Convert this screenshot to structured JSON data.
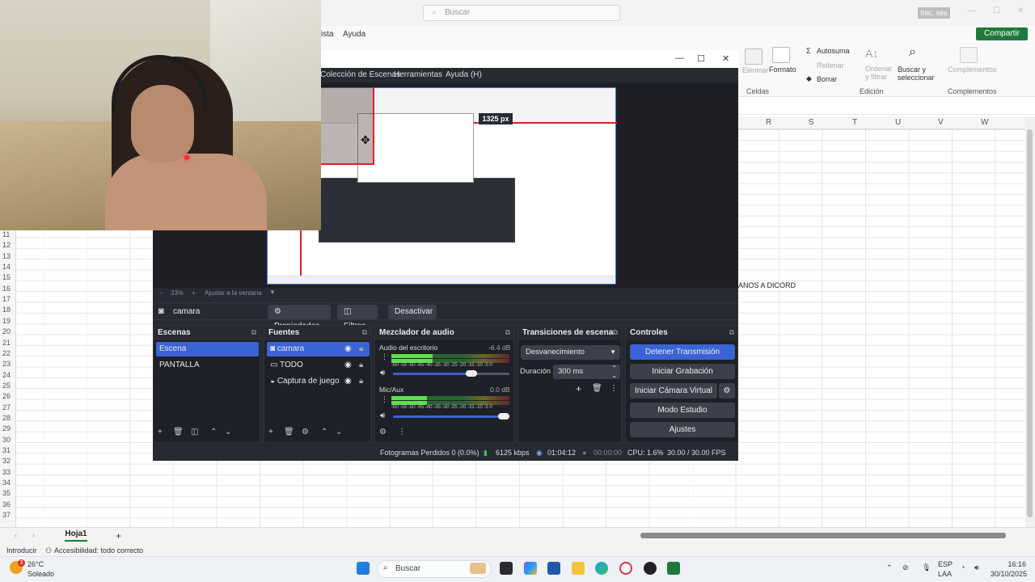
{
  "excel": {
    "search_placeholder": "Buscar",
    "signin": "Inic. ses",
    "menu": [
      "ista",
      "Ayuda"
    ],
    "share_label": "Compartir",
    "ribbon": {
      "autosuma": "Autosuma",
      "rellenar": "Rellenar",
      "borrar": "Borrar",
      "ordenar": "Ordenar y filtrar",
      "buscar": "Buscar y seleccionar",
      "complementos": "Complementos",
      "eliminar": "Eliminar",
      "formato": "Formato",
      "group_celdas": "Celdas",
      "group_edicion": "Edición",
      "group_complementos": "Complementos"
    },
    "columns": [
      "R",
      "S",
      "T",
      "U",
      "V",
      "W"
    ],
    "rows": [
      "11",
      "12",
      "13",
      "14",
      "15",
      "16",
      "17",
      "18",
      "19",
      "20",
      "21",
      "22",
      "23",
      "24",
      "25",
      "26",
      "27",
      "28",
      "29",
      "30",
      "31",
      "32",
      "33",
      "34",
      "35",
      "36",
      "37"
    ],
    "cell_text": "ANOS A DICORD",
    "sheet_tab": "Hoja1",
    "add_sheet": "+",
    "status_left": "Introducir",
    "status_access": "Accesibilidad: todo correcto"
  },
  "obs": {
    "menu": [
      "Colección de Escenas",
      "Herramientas",
      "Ayuda (H)"
    ],
    "px_label": "1325 px",
    "zoom_pct": "33%",
    "zoom_fit": "Ajustar a la ventana",
    "source_name": "camara",
    "src_buttons": {
      "props": "Propiedades",
      "filters": "Filtros",
      "deactivate": "Desactivar"
    },
    "docks": {
      "scenes": "Escenas",
      "sources": "Fuentes",
      "mixer": "Mezclador de audio",
      "transitions": "Transiciones de escena",
      "controls": "Controles"
    },
    "scenes": [
      "Escena",
      "PANTALLA"
    ],
    "sources": [
      "camara",
      "TODO",
      "Captura de juego"
    ],
    "mixer": [
      {
        "name": "Audio del escritorio",
        "db": "-6.4 dB",
        "level": 0.35,
        "volume": 0.72
      },
      {
        "name": "Mic/Aux",
        "db": "0.0 dB",
        "level": 0.3,
        "volume": 1.0
      }
    ],
    "meter_scale": "-60 -55 -50 -45 -40 -35 -30 -25 -20 -15 -10 -5 0",
    "transition": {
      "selected": "Desvanecimiento",
      "duration_label": "Duración",
      "duration": "300 ms"
    },
    "controls": [
      "Detener Transmisión",
      "Iniciar Grabación",
      "Iniciar Cámara Virtual",
      "Modo Estudio",
      "Ajustes"
    ],
    "status": {
      "dropped": "Fotogramas Perdidos 0 (0.0%)",
      "kbps": "6125 kbps",
      "live_time": "01:04:12",
      "rec_time": "00:00:00",
      "cpu": "CPU: 1.6%",
      "fps": "30.00 / 30.00 FPS"
    }
  },
  "taskbar": {
    "weather_temp": "26°C",
    "weather_desc": "Soleado",
    "search": "Buscar",
    "lang": "ESP",
    "lang_sub": "LAA",
    "time": "16:16",
    "date": "30/10/2025",
    "weather_badge": "3"
  },
  "colors": {
    "obs_bg": "#272a33",
    "obs_accent": "#3a63d6",
    "excel_green": "#1e7a3c",
    "record_red": "#e0202a"
  }
}
